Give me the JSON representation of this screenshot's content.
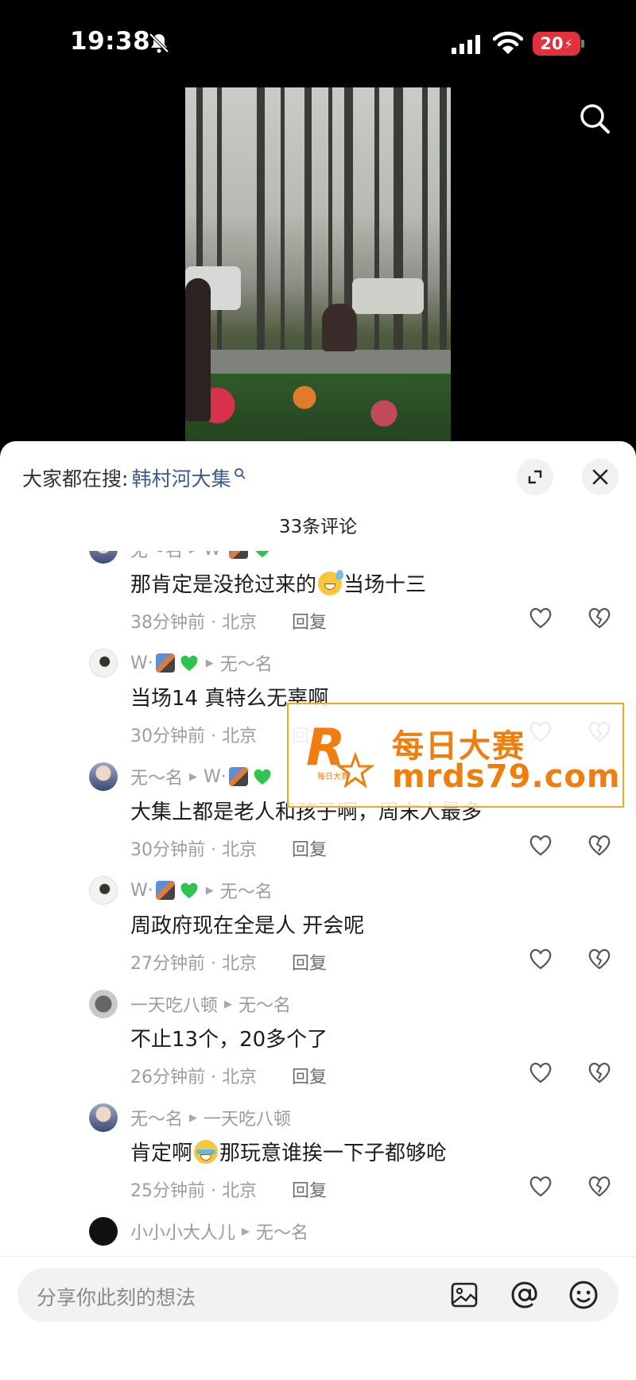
{
  "status_bar": {
    "time": "19:38",
    "battery": "20"
  },
  "sheet": {
    "hot_search_label": "大家都在搜:",
    "hot_search_keyword": "韩村河大集",
    "comment_count": "33条评论"
  },
  "comments": [
    {
      "author": "无～名",
      "reply_to": "W·",
      "text_before": "那肯定是没抢过来的",
      "emoji": "sweat-smile-emoji",
      "text_after": "当场十三",
      "meta": "38分钟前 · 北京",
      "reply_label": "回复"
    },
    {
      "author": "W·",
      "reply_to": "无～名",
      "text_before": "当场14 真特么无辜啊",
      "emoji": "",
      "text_after": "",
      "meta": "30分钟前 · 北京",
      "reply_label": "回复"
    },
    {
      "author": "无～名",
      "reply_to": "W·",
      "text_before": "大集上都是老人和孩子啊，周末人最多",
      "emoji": "",
      "text_after": "",
      "meta": "30分钟前 · 北京",
      "reply_label": "回复"
    },
    {
      "author": "W·",
      "reply_to": "无～名",
      "text_before": "周政府现在全是人 开会呢",
      "emoji": "",
      "text_after": "",
      "meta": "27分钟前 · 北京",
      "reply_label": "回复"
    },
    {
      "author": "一天吃八顿",
      "reply_to": "无～名",
      "text_before": "不止13个，20多个了",
      "emoji": "",
      "text_after": "",
      "meta": "26分钟前 · 北京",
      "reply_label": "回复"
    },
    {
      "author": "无～名",
      "reply_to": "一天吃八顿",
      "text_before": "肯定啊",
      "emoji": "crying-laughing-emoji",
      "text_after": "那玩意谁挨一下子都够呛",
      "meta": "25分钟前 · 北京",
      "reply_label": "回复"
    },
    {
      "author": "小小小大人儿",
      "reply_to": "无～名"
    }
  ],
  "watermark": {
    "line1": "每日大赛",
    "line2": "mrds79.com",
    "logo_letter": "R",
    "logo_sub": "每日大赛"
  },
  "input": {
    "placeholder": "分享你此刻的想法"
  },
  "colors": {
    "keyword": "#3b5b8a",
    "watermark": "#f07e0e",
    "battery": "#e0313c"
  }
}
